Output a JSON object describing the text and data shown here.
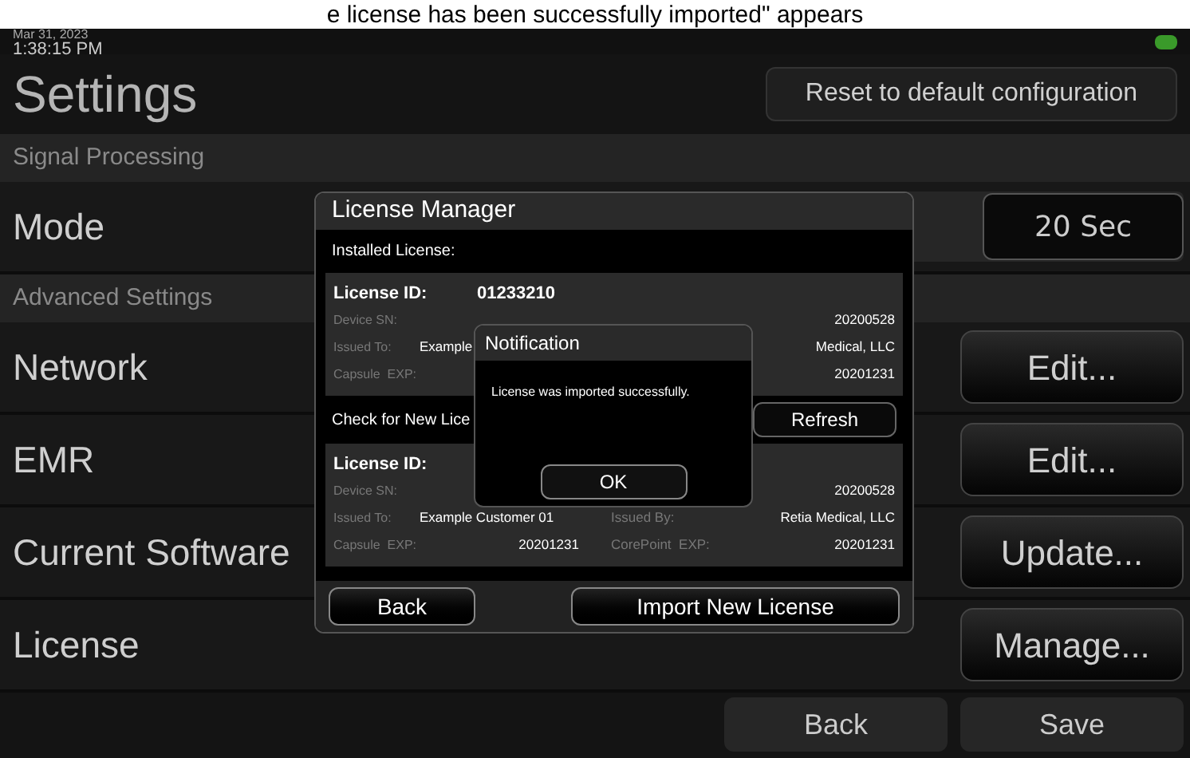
{
  "caption": "e license has been successfully imported\" appears",
  "status": {
    "date": "Mar 31, 2023",
    "time": "1:38:15 PM"
  },
  "title": "Settings",
  "reset_button": "Reset to default configuration",
  "sections": [
    {
      "header": "Signal Processing",
      "rows": [
        {
          "label": "Mode",
          "kind": "select",
          "button": "20 Sec"
        }
      ]
    },
    {
      "header": "Advanced Settings",
      "rows": [
        {
          "label": "Network",
          "kind": "button",
          "button": "Edit..."
        },
        {
          "label": "EMR",
          "kind": "button",
          "button": "Edit..."
        },
        {
          "label": "Current Software",
          "kind": "button",
          "button": "Update..."
        },
        {
          "label": "License",
          "kind": "button",
          "button": "Manage..."
        }
      ]
    }
  ],
  "footer_buttons": [
    "Back",
    "Save"
  ],
  "license_manager": {
    "title": "License Manager",
    "installed_label": "Installed License:",
    "installed": {
      "id_label": "License ID:",
      "id_value": "01233210",
      "rows": [
        {
          "label": "Device SN:",
          "value_2": "20200528"
        },
        {
          "label": "Issued To:",
          "value": "Example",
          "value_2": "Medical, LLC"
        },
        {
          "label": "Capsule  EXP:",
          "value_2": "20201231"
        }
      ]
    },
    "check_label": "Check for New Lice",
    "refresh_button": "Refresh",
    "new": {
      "id_label": "License ID:",
      "rows": [
        {
          "label": "Device SN:",
          "value_2": "20200528"
        },
        {
          "label": "Issued To:",
          "value": "Example Customer 01",
          "label_2": "Issued By:",
          "value_2": "Retia Medical, LLC"
        },
        {
          "label": "Capsule  EXP:",
          "value": "20201231",
          "label_2": "CorePoint  EXP:",
          "value_2": "20201231"
        }
      ]
    },
    "back_button": "Back",
    "import_button": "Import New License"
  },
  "notification": {
    "title": "Notification",
    "message": "License was imported successfully.",
    "ok_button": "OK"
  }
}
